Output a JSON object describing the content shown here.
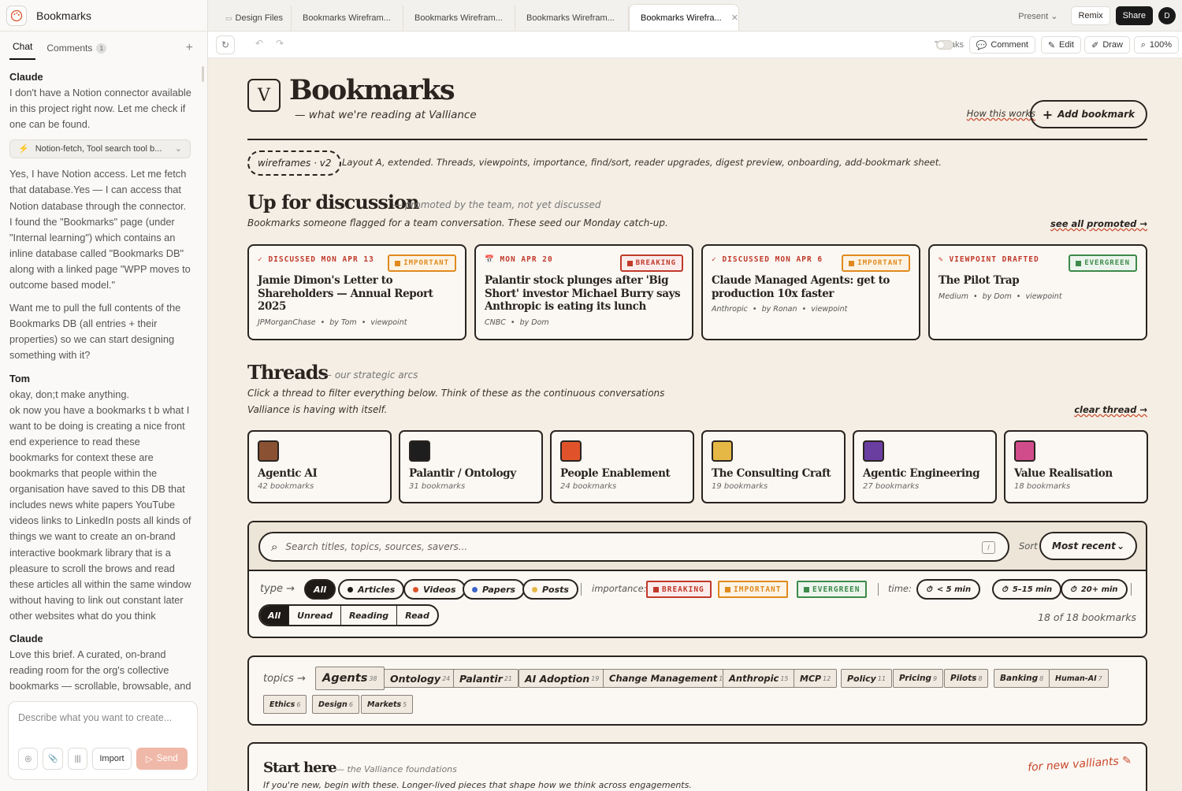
{
  "app": {
    "title": "Bookmarks"
  },
  "left": {
    "tabs": {
      "chat": "Chat",
      "comments": "Comments",
      "comments_count": "1"
    },
    "messages": {
      "claude1_name": "Claude",
      "claude1_text": "I don't have a Notion connector available in this project right now. Let me check if one can be found.",
      "tool_label": "Notion-fetch, Tool search tool b...",
      "claude1_text2": "Yes, I have Notion access. Let me fetch that database.Yes — I can access that Notion database through the connector. I found the \"Bookmarks\" page (under \"Internal learning\") which contains an inline database called \"Bookmarks DB\" along with a linked page \"WPP moves to outcome based model.\"",
      "claude1_text3": "Want me to pull the full contents of the Bookmarks DB (all entries + their properties) so we can start designing something with it?",
      "tom_name": "Tom",
      "tom_text1": "okay, don;t make anything.",
      "tom_text2": "ok now you have a bookmarks t b what I want to be doing is creating a nice front end experience to read these bookmarks for context these are bookmarks that people within the organisation have saved to this DB that includes news white papers YouTube videos links to LinkedIn posts all kinds of things we want to create an on-brand interactive bookmark library that is a pleasure to scroll the brows and read these articles all within the same window without having to link out constant later other websites what do you think",
      "claude2_name": "Claude",
      "claude2_text": "Love this brief. A curated, on-brand reading room for the org's collective bookmarks — scrollable, browsable, and"
    },
    "composer": {
      "placeholder": "Describe what you want to create...",
      "import": "Import",
      "send": "Send"
    }
  },
  "topbar": {
    "tabs": [
      {
        "label": "Design Files"
      },
      {
        "label": "Bookmarks Wirefram..."
      },
      {
        "label": "Bookmarks Wirefram..."
      },
      {
        "label": "Bookmarks Wirefram..."
      },
      {
        "label": "Bookmarks Wirefra..."
      }
    ],
    "present": "Present",
    "remix": "Remix",
    "share": "Share",
    "avatar": "D"
  },
  "toolbar": {
    "tweaks": "Tweaks",
    "comment": "Comment",
    "edit": "Edit",
    "draw": "Draw",
    "zoom": "100%"
  },
  "page": {
    "logo_letter": "V",
    "brand": "Bookmarks",
    "tagline": "— what we're reading at Valliance",
    "how_it_works": "How this works",
    "add_bookmark": "Add bookmark",
    "wireframe_pill": "wireframes · v2",
    "wireframe_desc": "Layout A, extended. Threads, viewpoints, importance, find/sort, reader upgrades, digest preview, onboarding, add-bookmark sheet.",
    "discussion": {
      "title": "Up for discussion",
      "subtitle": "— promoted by the team, not yet discussed",
      "desc": "Bookmarks someone flagged for a team conversation. These seed our Monday catch-up.",
      "see_all": "see all promoted →",
      "cards": [
        {
          "meta": "✓ DISCUSSED MON APR 13",
          "tag": "IMPORTANT",
          "title": "Jamie Dimon's Letter to Shareholders — Annual Report 2025",
          "source": "JPMorganChase",
          "by": "by Tom",
          "kind": "viewpoint"
        },
        {
          "meta": "📅 MON APR 20",
          "tag": "BREAKING",
          "title": "Palantir stock plunges after 'Big Short' investor Michael Burry says Anthropic is eating its lunch",
          "source": "CNBC",
          "by": "by Dom",
          "kind": ""
        },
        {
          "meta": "✓ DISCUSSED MON APR 6",
          "tag": "IMPORTANT",
          "title": "Claude Managed Agents: get to production 10x faster",
          "source": "Anthropic",
          "by": "by Ronan",
          "kind": "viewpoint"
        },
        {
          "meta": "✎ VIEWPOINT DRAFTED",
          "tag": "EVERGREEN",
          "title": "The Pilot Trap",
          "source": "Medium",
          "by": "by Dom",
          "kind": "viewpoint"
        }
      ]
    },
    "threads": {
      "title": "Threads",
      "subtitle": "— our strategic arcs",
      "desc1": "Click a thread to filter everything below. Think of these as the continuous conversations",
      "desc2": "Valliance is having with itself.",
      "clear": "clear thread →",
      "items": [
        {
          "name": "Agentic AI",
          "count": "42 bookmarks",
          "color": "#8a5233"
        },
        {
          "name": "Palantir / Ontology",
          "count": "31 bookmarks",
          "color": "#1e1e1e"
        },
        {
          "name": "People Enablement",
          "count": "24 bookmarks",
          "color": "#e0532a"
        },
        {
          "name": "The Consulting Craft",
          "count": "19 bookmarks",
          "color": "#e5b845"
        },
        {
          "name": "Agentic Engineering",
          "count": "27 bookmarks",
          "color": "#6a3ea1"
        },
        {
          "name": "Value Realisation",
          "count": "18 bookmarks",
          "color": "#d14c8b"
        }
      ]
    },
    "filters": {
      "search_placeholder": "Search titles, topics, sources, savers...",
      "slash": "/",
      "sort_label": "Sort",
      "sort_value": "Most recent",
      "type_label": "type →",
      "types": [
        "All",
        "Articles",
        "Videos",
        "Papers",
        "Posts"
      ],
      "type_colors": [
        "",
        "#1e1a17",
        "#d9532b",
        "#3d64c8",
        "#e5b845"
      ],
      "importance_label": "importance:",
      "importance": [
        "BREAKING",
        "IMPORTANT",
        "EVERGREEN"
      ],
      "time_label": "time:",
      "times": [
        "< 5 min",
        "5–15 min",
        "20+ min"
      ],
      "status": [
        "All",
        "Unread",
        "Reading",
        "Read"
      ],
      "count": "18 of 18 bookmarks"
    },
    "topics": {
      "label": "topics →",
      "items": [
        {
          "name": "Agents",
          "n": "38"
        },
        {
          "name": "Ontology",
          "n": "24"
        },
        {
          "name": "Palantir",
          "n": "21"
        },
        {
          "name": "AI Adoption",
          "n": "19"
        },
        {
          "name": "Change Management",
          "n": "17"
        },
        {
          "name": "Anthropic",
          "n": "15"
        },
        {
          "name": "MCP",
          "n": "12"
        },
        {
          "name": "Policy",
          "n": "11"
        },
        {
          "name": "Pricing",
          "n": "9"
        },
        {
          "name": "Pilots",
          "n": "8"
        },
        {
          "name": "Banking",
          "n": "8"
        },
        {
          "name": "Human-AI",
          "n": "7"
        },
        {
          "name": "Ethics",
          "n": "6"
        },
        {
          "name": "Design",
          "n": "6"
        },
        {
          "name": "Markets",
          "n": "5"
        }
      ]
    },
    "start": {
      "title": "Start here",
      "subtitle": "— the Valliance foundations",
      "desc": "If you're new, begin with these. Longer-lived pieces that shape how we think across engagements.",
      "note": "for new valliants ✎"
    }
  },
  "colors": {
    "accent": "#c9472a",
    "ink": "#2a2420",
    "paper": "#f4eee4",
    "important": "#e08a1e",
    "breaking": "#c0392b",
    "evergreen": "#3d8a4a"
  }
}
